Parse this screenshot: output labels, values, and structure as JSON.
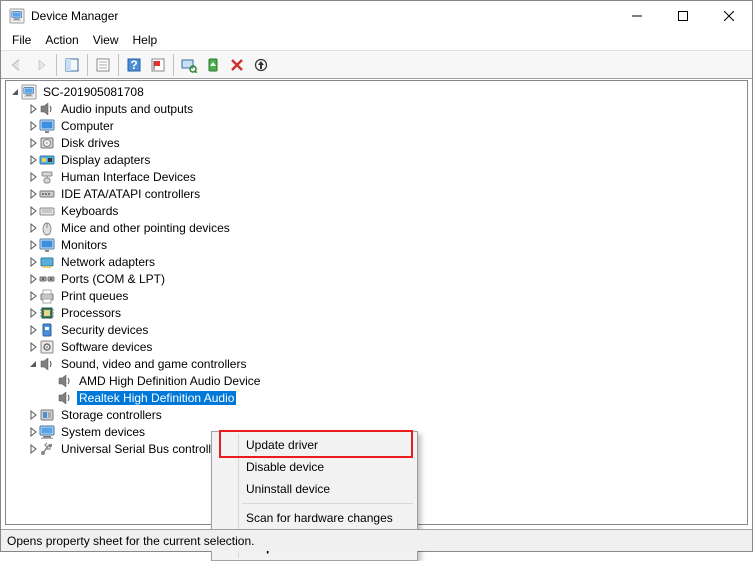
{
  "window": {
    "title": "Device Manager"
  },
  "menubar": {
    "file": "File",
    "action": "Action",
    "view": "View",
    "help": "Help"
  },
  "tree": {
    "root": "SC-201905081708",
    "nodes": {
      "audio_io": "Audio inputs and outputs",
      "computer": "Computer",
      "disk": "Disk drives",
      "display": "Display adapters",
      "hid": "Human Interface Devices",
      "ide": "IDE ATA/ATAPI controllers",
      "keyboards": "Keyboards",
      "mice": "Mice and other pointing devices",
      "monitors": "Monitors",
      "network": "Network adapters",
      "ports": "Ports (COM & LPT)",
      "printq": "Print queues",
      "processors": "Processors",
      "security": "Security devices",
      "software": "Software devices",
      "sound": "Sound, video and game controllers",
      "amd_audio": "AMD High Definition Audio Device",
      "realtek": "Realtek High Definition Audio",
      "storage": "Storage controllers",
      "system": "System devices",
      "usb": "Universal Serial Bus controllers"
    }
  },
  "context_menu": {
    "update": "Update driver",
    "disable": "Disable device",
    "uninstall": "Uninstall device",
    "scan": "Scan for hardware changes",
    "properties": "Properties"
  },
  "statusbar": {
    "text": "Opens property sheet for the current selection."
  }
}
